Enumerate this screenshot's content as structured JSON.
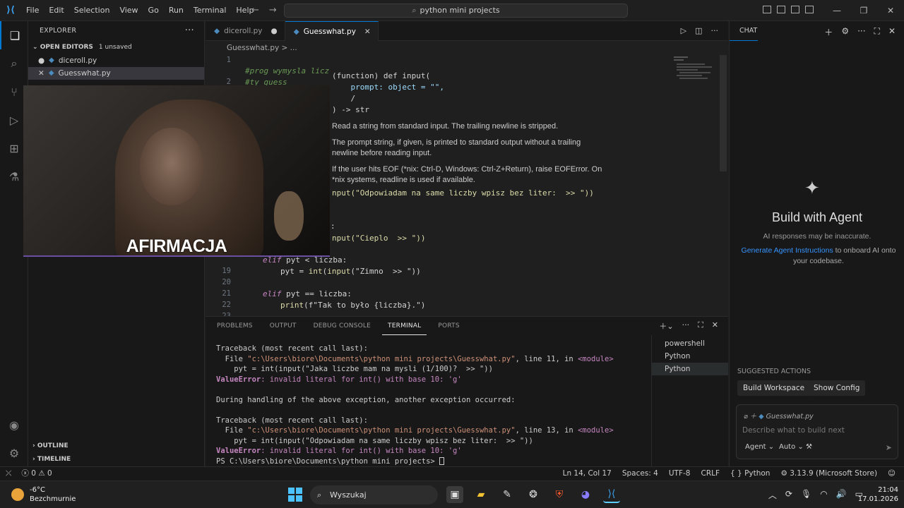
{
  "titlebar": {
    "menu": [
      "File",
      "Edit",
      "Selection",
      "View",
      "Go",
      "Run",
      "Terminal",
      "Help"
    ],
    "search": "python mini projects"
  },
  "sidebar": {
    "title": "EXPLORER",
    "open_editors_label": "OPEN EDITORS",
    "unsaved": "1 unsaved",
    "open_files": [
      "diceroll.py",
      "Guesswhat.py"
    ],
    "outline": "OUTLINE",
    "timeline": "TIMELINE"
  },
  "webcam": {
    "watermark": "AFIRMACJA"
  },
  "tabs": [
    {
      "label": "diceroll.py",
      "dirty": true
    },
    {
      "label": "Guesswhat.py",
      "active": true
    }
  ],
  "breadcrumb": "Guesswhat.py > ...",
  "editor": {
    "line_numbers": [
      "1",
      "2",
      "",
      "",
      "",
      "",
      "",
      "",
      "",
      "",
      "",
      "",
      "",
      "",
      "",
      "",
      "",
      "",
      "19",
      "20",
      "21",
      "22",
      "23"
    ],
    "lines": {
      "l1": "#prog wymysla licz",
      "l2": "#ty guess",
      "l14": "nput(\"Odpowiadam na same liczby wpisz bez liter:  >> \"))",
      "l16": ":",
      "l17": "nput(\"Cieplo  >> \"))",
      "l19a": "elif",
      "l19b": " pyt < liczba:",
      "l20a": "pyt",
      "l20b": " = ",
      "l20c": "int",
      "l20d": "(",
      "l20e": "input",
      "l20f": "(\"Zimno  >> \"))",
      "l22a": "elif",
      "l22b": " pyt == liczba:",
      "l23a": "print",
      "l23b": "(f\"Tak to było {liczba}.\")"
    }
  },
  "hover": {
    "sig1": "(function) def input(",
    "sig2": "    prompt: object = \"\",",
    "sig3": "    /",
    "sig4": ") -> str",
    "doc1": "Read a string from standard input. The trailing newline is stripped.",
    "doc2": "The prompt string, if given, is printed to standard output without a trailing newline before reading input.",
    "doc3": "If the user hits EOF (*nix: Ctrl-D, Windows: Ctrl-Z+Return), raise EOFError. On *nix systems, readline is used if available."
  },
  "panel": {
    "tabs": [
      "PROBLEMS",
      "OUTPUT",
      "DEBUG CONSOLE",
      "TERMINAL",
      "PORTS"
    ],
    "active_tab": "TERMINAL",
    "terminals": [
      "powershell",
      "Python",
      "Python"
    ],
    "term": {
      "t1": "Traceback (most recent call last):",
      "t2a": "  File ",
      "t2b": "\"c:\\Users\\biore\\Documents\\python mini projects\\Guesswhat.py\"",
      "t2c": ", line 11, in ",
      "t2d": "<module>",
      "t3": "    pyt = int(input(\"Jaka liczbe mam na mysli (1/100)?  >> \"))",
      "t4a": "ValueError",
      "t4b": ": invalid literal for int() with base 10: 'g'",
      "t5": "",
      "t6": "During handling of the above exception, another exception occurred:",
      "t7": "",
      "t8": "Traceback (most recent call last):",
      "t9a": "  File ",
      "t9b": "\"c:\\Users\\biore\\Documents\\python mini projects\\Guesswhat.py\"",
      "t9c": ", line 13, in ",
      "t9d": "<module>",
      "t10": "    pyt = int(input(\"Odpowiadam na same liczby wpisz bez liter:  >> \"))",
      "t11a": "ValueError",
      "t11b": ": invalid literal for int() with base 10: 'g'",
      "t12": "PS C:\\Users\\biore\\Documents\\python mini projects> "
    }
  },
  "chat": {
    "header": "CHAT",
    "title": "Build with Agent",
    "subtitle": "AI responses may be inaccurate.",
    "gen_link": "Generate Agent Instructions",
    "gen_rest": " to onboard AI onto your codebase.",
    "suggested": "SUGGESTED ACTIONS",
    "btn1": "Build Workspace",
    "btn2": "Show Config",
    "context_file": "Guesswhat.py",
    "placeholder": "Describe what to build next",
    "mode": "Agent",
    "model": "Auto"
  },
  "status": {
    "errors": "0",
    "warnings": "0",
    "position": "Ln 14, Col 17",
    "spaces": "Spaces: 4",
    "encoding": "UTF-8",
    "eol": "CRLF",
    "language": "Python",
    "interpreter": "3.13.9 (Microsoft Store)"
  },
  "taskbar": {
    "temp": "-6°C",
    "weather": "Bezchmurnie",
    "search": "Wyszukaj",
    "time": "21:04",
    "date": "17.01.2026"
  }
}
